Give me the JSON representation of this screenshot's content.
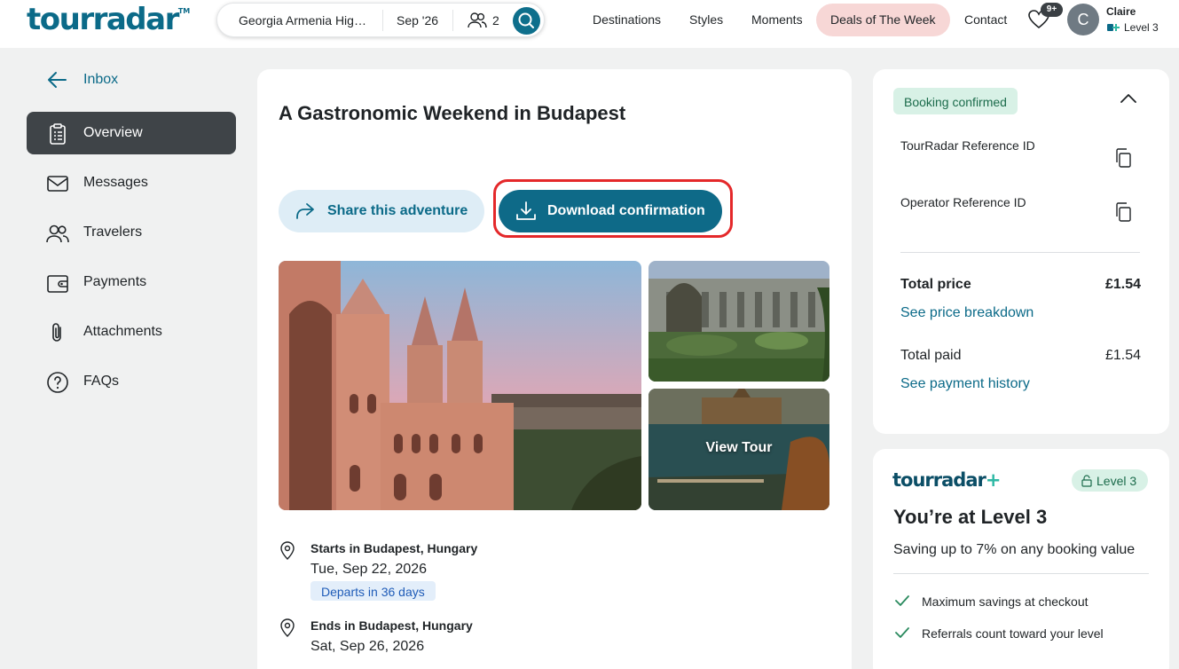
{
  "header": {
    "logo": "tourradar",
    "logo_tm": "TM",
    "search": {
      "destination": "Georgia Armenia Hig…",
      "date": "Sep '26",
      "travelers": "2"
    },
    "nav": [
      "Destinations",
      "Styles",
      "Moments"
    ],
    "deals": "Deals of The Week",
    "contact": "Contact",
    "wishlist_badge": "9+",
    "user": {
      "initial": "C",
      "name": "Claire",
      "level": "Level 3"
    }
  },
  "sidebar": {
    "back": "Inbox",
    "items": [
      {
        "label": "Overview",
        "icon": "clipboard-icon",
        "active": true
      },
      {
        "label": "Messages",
        "icon": "envelope-icon"
      },
      {
        "label": "Travelers",
        "icon": "people-icon"
      },
      {
        "label": "Payments",
        "icon": "wallet-icon"
      },
      {
        "label": "Attachments",
        "icon": "paperclip-icon"
      },
      {
        "label": "FAQs",
        "icon": "question-icon"
      }
    ]
  },
  "main": {
    "title": "A Gastronomic Weekend in Budapest",
    "share_label": "Share this adventure",
    "download_label": "Download confirmation",
    "view_tour": "View Tour",
    "start": {
      "title": "Starts in Budapest, Hungary",
      "date": "Tue, Sep 22, 2026",
      "departs": "Departs in 36 days"
    },
    "end": {
      "title": "Ends in Budapest, Hungary",
      "date": "Sat, Sep 26, 2026"
    }
  },
  "booking": {
    "status": "Booking confirmed",
    "ref1": "TourRadar Reference ID",
    "ref2": "Operator Reference ID",
    "total_label": "Total price",
    "total_value": "£1.54",
    "price_link": "See price breakdown",
    "paid_label": "Total paid",
    "paid_value": "£1.54",
    "payment_link": "See payment history"
  },
  "level": {
    "logo": "tourradar",
    "logo_plus": "+",
    "badge": "Level 3",
    "title": "You’re at Level 3",
    "subtitle": "Saving up to 7% on any booking value",
    "features": [
      "Maximum savings at checkout",
      "Referrals count toward your level"
    ]
  },
  "colors": {
    "brand": "#0b6a88",
    "highlight": "#e4282a",
    "deals_bg": "#f7d7d6",
    "confirmed_bg": "#d8f1e6"
  }
}
